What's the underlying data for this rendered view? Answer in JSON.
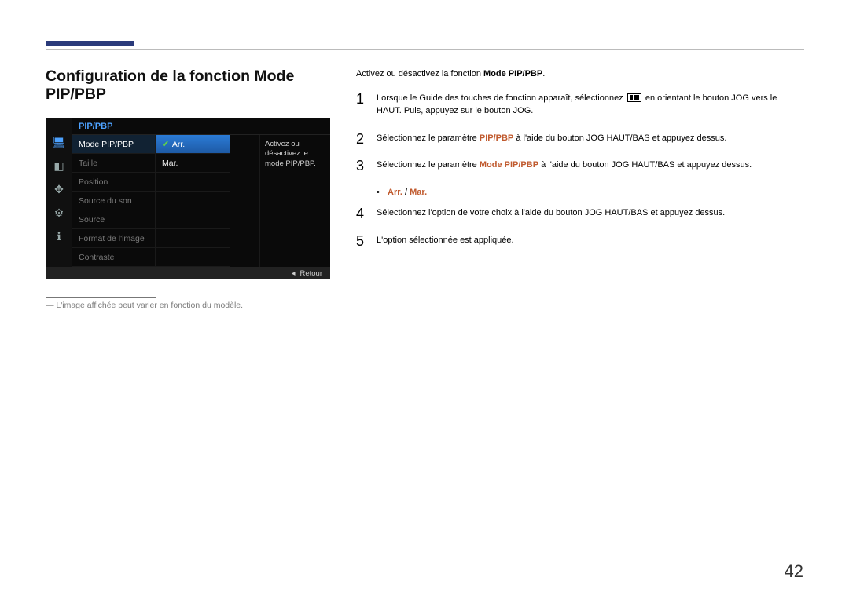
{
  "page_number": "42",
  "title": "Configuration de la fonction Mode PIP/PBP",
  "osd": {
    "header": "PIP/PBP",
    "rows": [
      {
        "label": "Mode PIP/PBP",
        "value": "Arr.",
        "active": true,
        "highlight": true,
        "checked": true
      },
      {
        "label": "Taille",
        "value": "Mar.",
        "active": false,
        "highlight": false,
        "checked": false
      },
      {
        "label": "Position",
        "value": "",
        "active": false
      },
      {
        "label": "Source du son",
        "value": "",
        "active": false
      },
      {
        "label": "Source",
        "value": "",
        "active": false
      },
      {
        "label": "Format de l'image",
        "value": "",
        "active": false
      },
      {
        "label": "Contraste",
        "value": "",
        "active": false
      }
    ],
    "side_text": "Activez ou désactivez le mode PIP/PBP.",
    "footer": {
      "arrow": "◂",
      "label": "Retour"
    }
  },
  "caption": "L'image affichée peut varier en fonction du modèle.",
  "intro": {
    "pre": "Activez ou désactivez la fonction ",
    "em": "Mode PIP/PBP",
    "post": "."
  },
  "steps": {
    "s1": {
      "pre": "Lorsque le Guide des touches de fonction apparaît, sélectionnez ",
      "post": " en orientant le bouton JOG vers le HAUT. Puis, appuyez sur le bouton JOG."
    },
    "s2": {
      "pre": "Sélectionnez le paramètre ",
      "em": "PIP/PBP",
      "post": " à l'aide du bouton JOG HAUT/BAS et appuyez dessus."
    },
    "s3": {
      "pre": "Sélectionnez le paramètre ",
      "em": "Mode PIP/PBP",
      "post": " à l'aide du bouton JOG HAUT/BAS et appuyez dessus."
    },
    "bullet": {
      "a": "Arr.",
      "sep": " / ",
      "b": "Mar."
    },
    "s4": "Sélectionnez l'option de votre choix à l'aide du bouton JOG HAUT/BAS et appuyez dessus.",
    "s5": "L'option sélectionnée est appliquée."
  },
  "nums": {
    "1": "1",
    "2": "2",
    "3": "3",
    "4": "4",
    "5": "5"
  }
}
